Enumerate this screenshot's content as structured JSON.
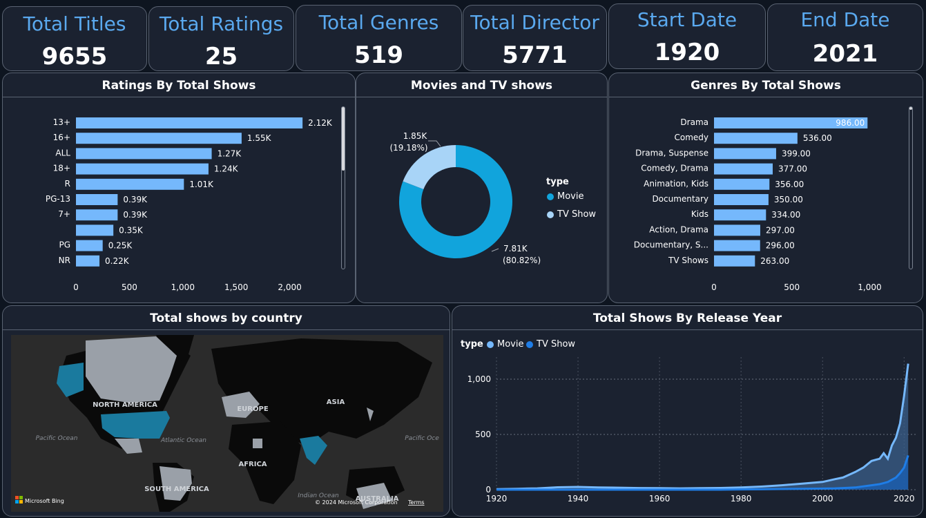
{
  "kpis": [
    {
      "label": "Total Titles",
      "value": "9655"
    },
    {
      "label": "Total Ratings",
      "value": "25"
    },
    {
      "label": "Total Genres",
      "value": "519"
    },
    {
      "label": "Total Director",
      "value": "5771"
    },
    {
      "label": "Start Date",
      "value": "1920"
    },
    {
      "label": "End Date",
      "value": "2021"
    }
  ],
  "panels": {
    "ratings_title": "Ratings By Total Shows",
    "pie_title": "Movies and TV shows",
    "genres_title": "Genres By Total Shows",
    "map_title": "Total shows by country",
    "year_title": "Total Shows By Release Year"
  },
  "map": {
    "labels": {
      "north_america": "NORTH AMERICA",
      "europe": "EUROPE",
      "asia": "ASIA",
      "africa": "AFRICA",
      "south_america": "SOUTH AMERICA",
      "australia": "AUSTRALIA",
      "pacific_left": "Pacific Ocean",
      "pacific_right": "Pacific Oce",
      "atlantic": "Atlantic Ocean",
      "indian": "Indian Ocean"
    },
    "attribution": "Microsoft Bing",
    "copyright": "© 2024 Microsoft Corporation",
    "terms": "Terms",
    "highlight_color": "#1a7a9e"
  },
  "chart_data": [
    {
      "type": "bar",
      "orientation": "horizontal",
      "categories": [
        "13+",
        "16+",
        "ALL",
        "18+",
        "R",
        "PG-13",
        "7+",
        "",
        "PG",
        "NR"
      ],
      "values": [
        2120,
        1550,
        1270,
        1240,
        1010,
        390,
        390,
        350,
        250,
        220
      ],
      "data_labels": [
        "2.12K",
        "1.55K",
        "1.27K",
        "1.24K",
        "1.01K",
        "0.39K",
        "0.39K",
        "0.35K",
        "0.25K",
        "0.22K"
      ],
      "xticks": [
        "0",
        "500",
        "1,000",
        "1,500",
        "2,000"
      ],
      "xlim": [
        0,
        2300
      ],
      "color": "#75b8fc"
    },
    {
      "type": "pie",
      "donut": true,
      "legend_title": "type",
      "slices": [
        {
          "name": "Movie",
          "value": 7810,
          "label": "7.81K",
          "pct": "(80.82%)",
          "color": "#11a4dc"
        },
        {
          "name": "TV Show",
          "value": 1850,
          "label": "1.85K",
          "pct": "(19.18%)",
          "color": "#a8d4f7"
        }
      ]
    },
    {
      "type": "bar",
      "orientation": "horizontal",
      "categories": [
        "Drama",
        "Comedy",
        "Drama, Suspense",
        "Comedy, Drama",
        "Animation, Kids",
        "Documentary",
        "Kids",
        "Action, Drama",
        "Documentary, S...",
        "TV Shows"
      ],
      "values": [
        986,
        536,
        399,
        377,
        356,
        350,
        334,
        297,
        296,
        263
      ],
      "data_labels": [
        "986.00",
        "536.00",
        "399.00",
        "377.00",
        "356.00",
        "350.00",
        "334.00",
        "297.00",
        "296.00",
        "263.00"
      ],
      "xticks": [
        "0",
        "500",
        "1,000"
      ],
      "xlim": [
        0,
        1100
      ],
      "color": "#75b8fc"
    },
    {
      "type": "area",
      "legend_title": "type",
      "x": [
        1920,
        1925,
        1930,
        1935,
        1940,
        1945,
        1950,
        1955,
        1960,
        1965,
        1970,
        1975,
        1980,
        1985,
        1990,
        1995,
        2000,
        2003,
        2005,
        2008,
        2010,
        2012,
        2014,
        2015,
        2016,
        2017,
        2018,
        2019,
        2020,
        2021
      ],
      "series": [
        {
          "name": "Movie",
          "color": "#75b8fc",
          "values": [
            5,
            8,
            12,
            22,
            25,
            20,
            18,
            15,
            14,
            12,
            14,
            16,
            20,
            28,
            40,
            55,
            70,
            95,
            110,
            160,
            200,
            260,
            280,
            330,
            280,
            400,
            470,
            600,
            850,
            1140
          ]
        },
        {
          "name": "TV Show",
          "color": "#1f7de6",
          "values": [
            0,
            0,
            0,
            0,
            0,
            0,
            0,
            0,
            0,
            0,
            0,
            0,
            2,
            4,
            6,
            8,
            10,
            12,
            15,
            20,
            30,
            40,
            50,
            60,
            70,
            90,
            110,
            150,
            200,
            310
          ]
        }
      ],
      "xticks": [
        "1920",
        "1940",
        "1960",
        "1980",
        "2000",
        "2020"
      ],
      "yticks": [
        "0",
        "500",
        "1,000"
      ],
      "xlim": [
        1920,
        2023
      ],
      "ylim": [
        0,
        1200
      ]
    }
  ]
}
